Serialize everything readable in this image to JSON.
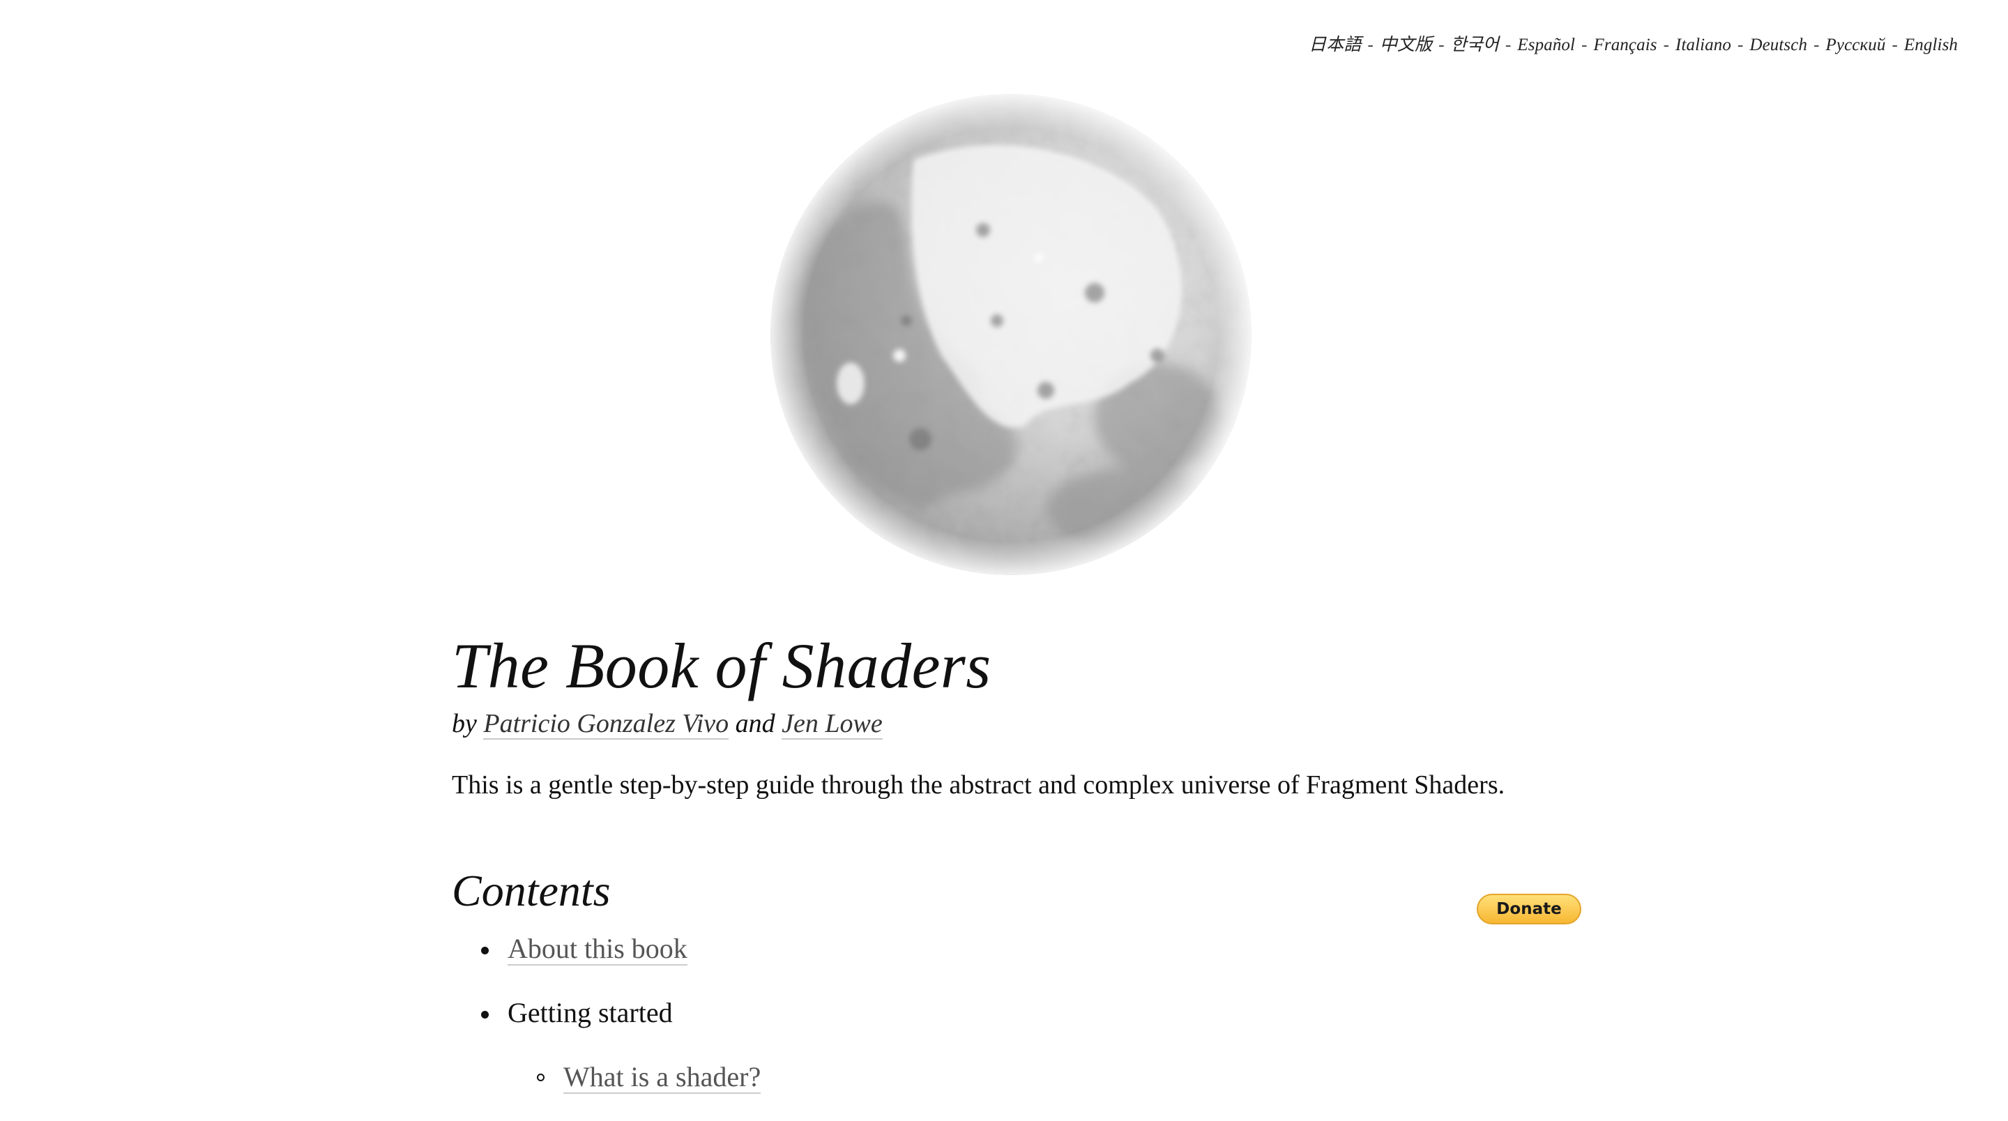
{
  "languages": [
    {
      "label": "日本語"
    },
    {
      "label": "中文版"
    },
    {
      "label": "한국어"
    },
    {
      "label": "Español"
    },
    {
      "label": "Français"
    },
    {
      "label": "Italiano"
    },
    {
      "label": "Deutsch"
    },
    {
      "label": "Русский"
    },
    {
      "label": "English"
    }
  ],
  "language_separator": "-",
  "hero": {
    "image": "moon-image"
  },
  "title": "The Book of Shaders",
  "byline": {
    "prefix": "by",
    "author1": "Patricio Gonzalez Vivo",
    "conjunction": "and",
    "author2": "Jen Lowe"
  },
  "intro": "This is a gentle step-by-step guide through the abstract and complex universe of Fragment Shaders.",
  "contents": {
    "heading": "Contents",
    "donate_label": "Donate",
    "items": [
      {
        "label": "About this book"
      },
      {
        "label": "Getting started",
        "children": [
          {
            "label": "What is a shader?"
          }
        ]
      }
    ]
  },
  "colors": {
    "background": "#ffffff",
    "text": "#111111",
    "link": "#555555",
    "donate": "#f7c042"
  }
}
